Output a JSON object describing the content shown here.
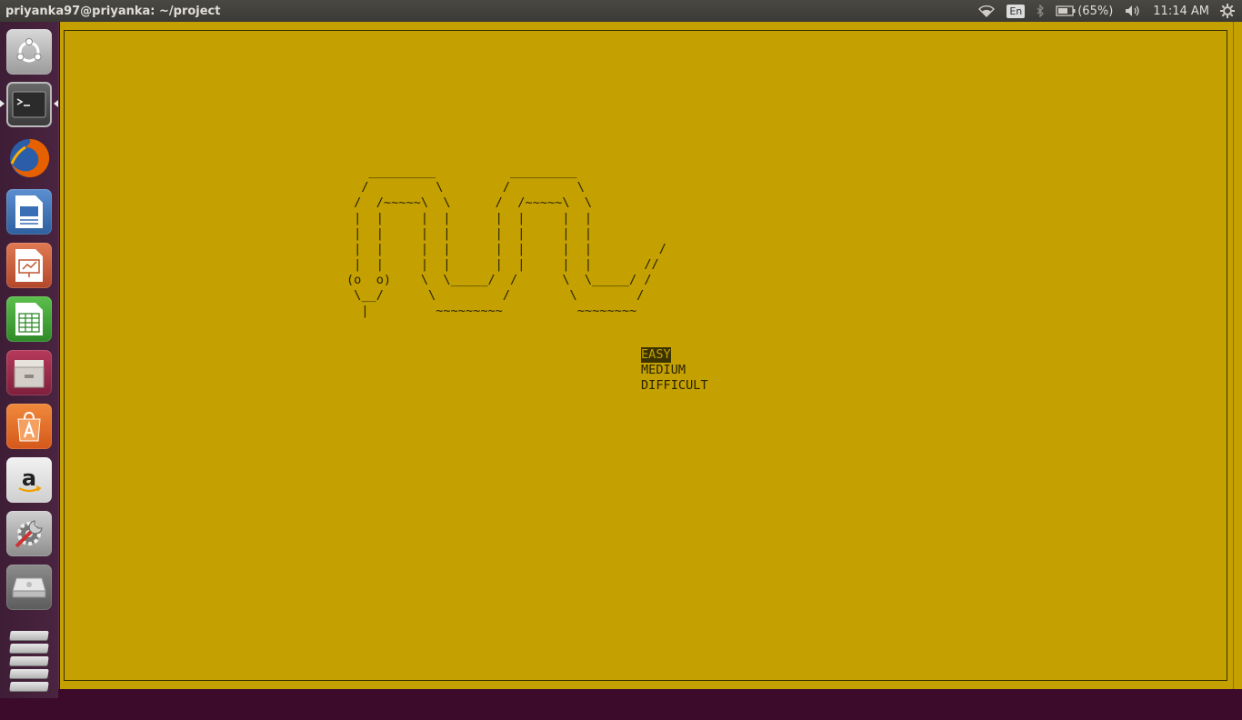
{
  "window": {
    "title": "priyanka97@priyanka: ~/project"
  },
  "panel": {
    "keyboard_layout": "En",
    "battery": "(65%)",
    "clock": "11:14 AM"
  },
  "launcher": {
    "items": [
      {
        "name": "Ubuntu Dash",
        "icon": "ubuntu-logo-icon"
      },
      {
        "name": "Terminal",
        "icon": "terminal-icon",
        "active": true
      },
      {
        "name": "Firefox",
        "icon": "firefox-icon"
      },
      {
        "name": "LibreOffice Writer",
        "icon": "writer-icon"
      },
      {
        "name": "LibreOffice Impress",
        "icon": "impress-icon"
      },
      {
        "name": "LibreOffice Calc",
        "icon": "calc-icon"
      },
      {
        "name": "Files",
        "icon": "files-icon"
      },
      {
        "name": "Ubuntu Software",
        "icon": "software-center-icon"
      },
      {
        "name": "Amazon",
        "icon": "amazon-icon"
      },
      {
        "name": "System Settings",
        "icon": "settings-icon"
      },
      {
        "name": "Drive",
        "icon": "drive-icon"
      },
      {
        "name": "Trash",
        "icon": "trash-icon"
      }
    ]
  },
  "game": {
    "ascii_art": "   _________          _________\n  /         \\        /         \\\n /  /~~~~~\\  \\      /  /~~~~~\\  \\\n |  |     |  |      |  |     |  |\n |  |     |  |      |  |     |  |\n |  |     |  |      |  |     |  |         /\n |  |     |  |      |  |     |  |       //\n(o  o)    \\  \\_____/  /      \\  \\_____/ /\n \\__/      \\         /        \\        /\n  |         ~~~~~~~~~          ~~~~~~~~",
    "menu": {
      "options": [
        "EASY",
        "MEDIUM",
        "DIFFICULT"
      ],
      "selected": "EASY"
    }
  },
  "colors": {
    "terminal_bg": "#c4a000",
    "terminal_fg": "#2a2400",
    "desktop_bg": "#3c0a2a"
  }
}
